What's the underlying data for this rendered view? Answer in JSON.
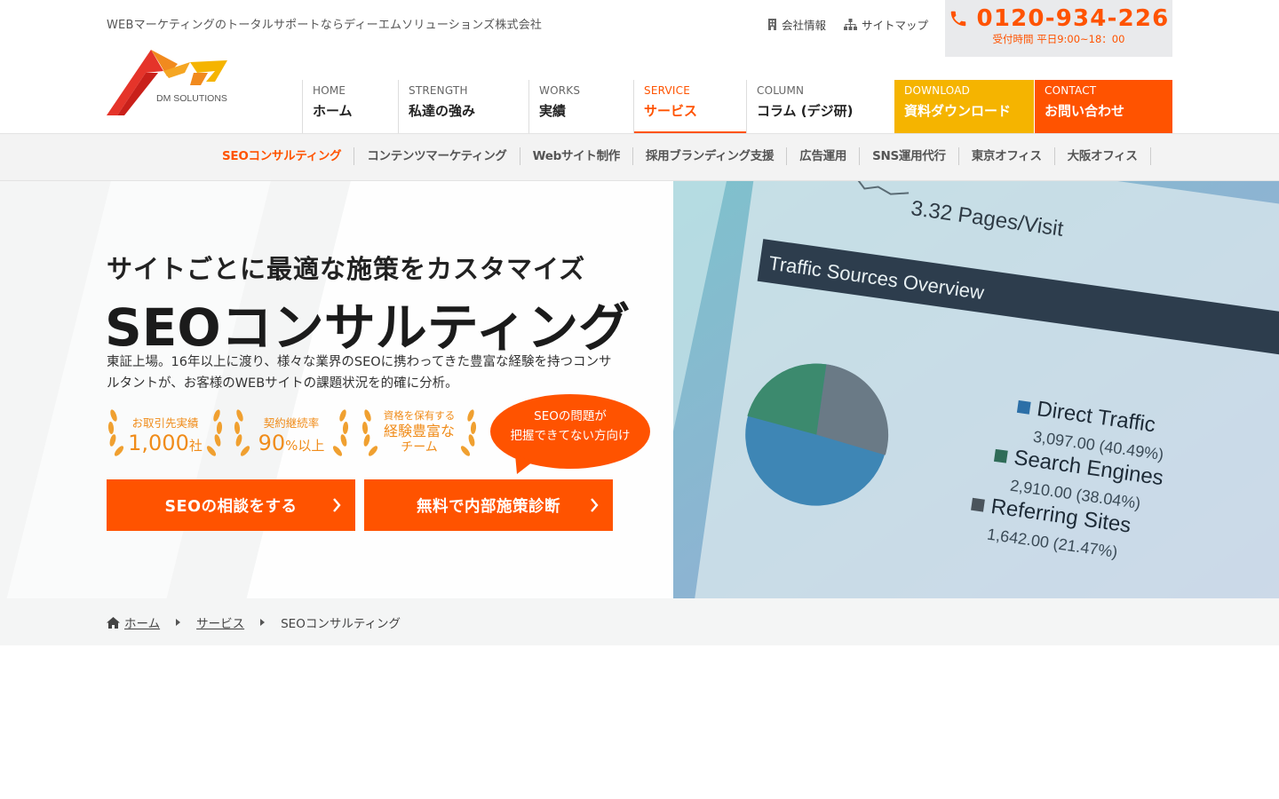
{
  "header": {
    "tagline": "WEBマーケティングのトータルサポートならディーエムソリューションズ株式会社",
    "utility_links": [
      {
        "label": "会社情報",
        "icon": "building-icon"
      },
      {
        "label": "サイトマップ",
        "icon": "sitemap-icon"
      }
    ],
    "phone": {
      "number": "0120-934-226",
      "hours": "受付時間 平日9:00~18：00",
      "icon": "phone-icon"
    },
    "logo_text": "DM SOLUTIONS"
  },
  "gnav": [
    {
      "en": "HOME",
      "ja": "ホーム"
    },
    {
      "en": "STRENGTH",
      "ja": "私達の強み"
    },
    {
      "en": "WORKS",
      "ja": "実績"
    },
    {
      "en": "SERVICE",
      "ja": "サービス"
    },
    {
      "en": "COLUMN",
      "ja": "コラム (デジ研)"
    },
    {
      "en": "DOWNLOAD",
      "ja": "資料ダウンロード"
    },
    {
      "en": "CONTACT",
      "ja": "お問い合わせ"
    }
  ],
  "subnav": [
    "SEOコンサルティング",
    "コンテンツマーケティング",
    "Webサイト制作",
    "採用ブランディング支援",
    "広告運用",
    "SNS運用代行",
    "東京オフィス",
    "大阪オフィス"
  ],
  "hero": {
    "subtitle": "サイトごとに最適な施策をカスタマイズ",
    "title": "SEOコンサルティング",
    "description": "東証上場。16年以上に渡り、様々な業界のSEOに携わってきた豊富な経験を持つコンサルタントが、お客様のWEBサイトの課題状況を的確に分析。",
    "badges": [
      {
        "label": "お取引先実績",
        "value": "1,000",
        "unit": "社"
      },
      {
        "label": "契約継続率",
        "value": "90",
        "unit": "%以上"
      },
      {
        "label": "資格を保有する",
        "line2": "経験豊富な",
        "line3": "チーム"
      }
    ],
    "bubble": {
      "line1": "SEOの問題が",
      "line2": "把握できてない方向け"
    },
    "cta_primary": "SEOの相談をする",
    "cta_secondary": "無料で内部施策診断",
    "photo": {
      "pages_visit": "3.32 Pages/Visit",
      "panel_title": "Traffic Sources Overview",
      "legend": [
        {
          "name": "Direct Traffic",
          "value": "3,097.00 (40.49%)"
        },
        {
          "name": "Search Engines",
          "value": "2,910.00 (38.04%)"
        },
        {
          "name": "Referring Sites",
          "value": "1,642.00 (21.47%)"
        }
      ]
    }
  },
  "breadcrumb": [
    "ホーム",
    "サービス",
    "SEOコンサルティング"
  ],
  "colors": {
    "accent": "#ff5300",
    "download": "#f5b400",
    "badge_gold": "#f08c1a"
  }
}
